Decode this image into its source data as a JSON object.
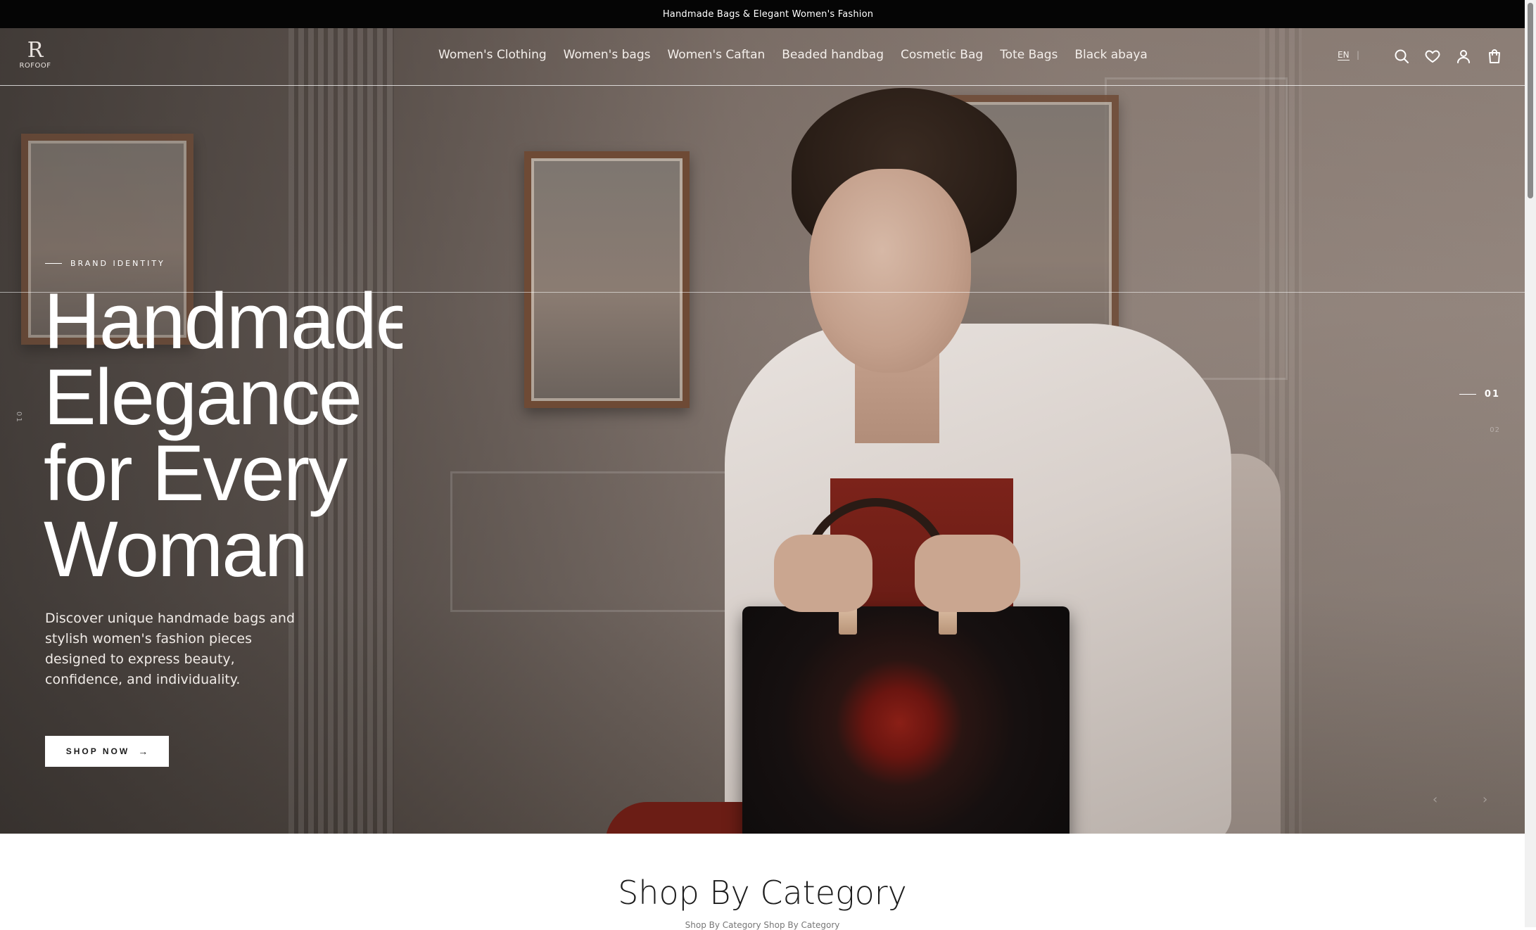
{
  "announcement": {
    "text": "Handmade Bags & Elegant Women's Fashion"
  },
  "brand": {
    "logo_mark": "R",
    "logo_text": "ROFOOF"
  },
  "nav": {
    "items": [
      "Women's Clothing",
      "Women's bags",
      "Women's Caftan",
      "Beaded handbag",
      "Cosmetic Bag",
      "Tote Bags",
      "Black abaya"
    ]
  },
  "header": {
    "language": "EN",
    "icons": [
      "search-icon",
      "heart-icon",
      "user-icon",
      "cart-icon"
    ]
  },
  "hero": {
    "eyebrow": "BRAND IDENTITY",
    "headline_lines": [
      "Handmade",
      "Elegance",
      "for Every",
      "Woman"
    ],
    "description": "Discover unique handmade bags and stylish women's fashion pieces designed to express beauty, confidence, and individuality.",
    "cta_label": "SHOP NOW",
    "cta_arrow": "→",
    "slide_current": "01",
    "slide_next": "02",
    "side_index": "01",
    "prev_arrow": "‹",
    "next_arrow": "›"
  },
  "category": {
    "title": "Shop By Category",
    "subtitle": "Shop By Category Shop By Category"
  },
  "colors": {
    "announcement_bg": "#050505",
    "text_light": "#ffffff",
    "button_bg": "#ffffff",
    "button_text": "#1a1a1a"
  }
}
